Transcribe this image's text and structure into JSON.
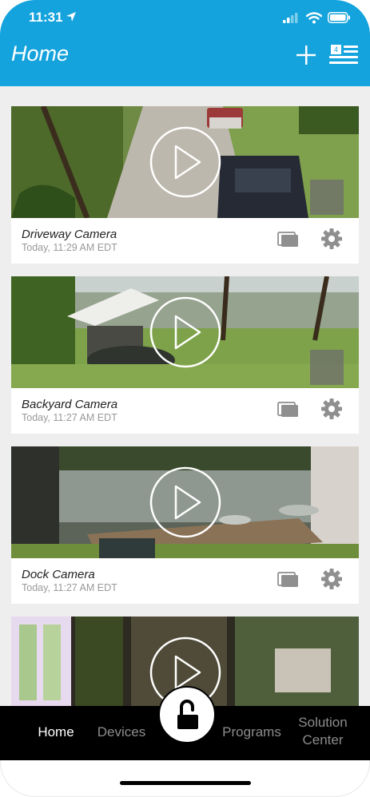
{
  "status_bar": {
    "time": "11:31"
  },
  "header": {
    "title": "Home",
    "menu_badge": "4"
  },
  "cameras": [
    {
      "name": "Driveway Camera",
      "timestamp": "Today, 11:29 AM EDT"
    },
    {
      "name": "Backyard Camera",
      "timestamp": "Today, 11:27 AM EDT"
    },
    {
      "name": "Dock Camera",
      "timestamp": "Today, 11:27 AM EDT"
    }
  ],
  "tabs": {
    "home": "Home",
    "devices": "Devices",
    "programs": "Programs",
    "solution_line1": "Solution",
    "solution_line2": "Center"
  },
  "icons": [
    "location-arrow-icon",
    "signal-icon",
    "wifi-icon",
    "battery-icon",
    "plus-icon",
    "menu-list-icon",
    "play-icon",
    "clips-icon",
    "gear-icon",
    "unlock-icon"
  ],
  "colors": {
    "header": "#14a3dc",
    "tabbar": "#000000",
    "feed_bg": "#eeeeee"
  }
}
